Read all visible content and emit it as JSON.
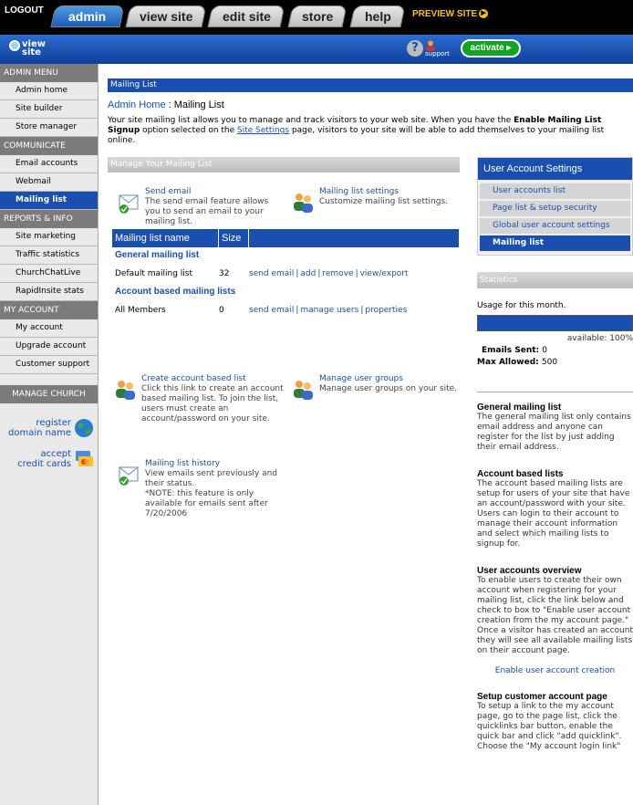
{
  "topbar": {
    "logout": "LOGOUT",
    "tabs": [
      "admin",
      "view site",
      "edit site",
      "store",
      "help"
    ],
    "preview": "PREVIEW SITE",
    "view_site_icon_label": "view site",
    "support_label": "support",
    "activate": "activate"
  },
  "sidebar": {
    "admin_menu": "ADMIN MENU",
    "admin_items": [
      "Admin home",
      "Site builder",
      "Store manager"
    ],
    "communicate": "COMMUNICATE",
    "communicate_items": [
      "Email accounts",
      "Webmail",
      "Mailing list"
    ],
    "reports": "REPORTS & INFO",
    "reports_items": [
      "Site marketing",
      "Traffic statistics",
      "ChurchChatLive",
      "RapidInsite stats"
    ],
    "my_account": "MY ACCOUNT",
    "account_items": [
      "My account",
      "Upgrade account",
      "Customer support"
    ],
    "manage_church": "MANAGE CHURCH",
    "register_domain_1": "register",
    "register_domain_2": "domain name",
    "accept_cards_1": "accept",
    "accept_cards_2": "credit cards"
  },
  "main": {
    "title": "Mailing List",
    "crumb_home": "Admin Home",
    "crumb_sep": " : ",
    "crumb_current": "Mailing List",
    "intro_1": "Your site mailing list allows you to manage and track visitors to your web site. When you have the ",
    "intro_bold": "Enable Mailing List Signup",
    "intro_2": " option selected on the ",
    "intro_link": "Site Settings",
    "intro_3": " page, visitors to your site will be able to add themselves to your mailing list online.",
    "manage_head": "Manage Your Mailing List",
    "send_email_title": "Send email",
    "send_email_desc": "The send email feature allows you to send an email to your mailing list.",
    "settings_title": "Mailing list settings",
    "settings_desc": "Customize mailing list settings.",
    "table_headers": [
      "Mailing list name",
      "Size"
    ],
    "general_section": "General mailing list",
    "general_row": {
      "name": "Default mailing list",
      "size": "32",
      "actions": [
        "send email",
        "add",
        "remove",
        "view/export"
      ]
    },
    "account_section": "Account based mailing lists",
    "account_row": {
      "name": "All Members",
      "size": "0",
      "actions": [
        "send email",
        "manage users",
        "properties"
      ]
    },
    "create_title": "Create account based list",
    "create_desc": "Click this link to create an account based mailing list. To join the list, users must create an account/password on your site.",
    "groups_title": "Manage user groups",
    "groups_desc": "Manage user groups on your site.",
    "history_title": "Mailing list history",
    "history_desc_1": "View emails sent previously and their status.",
    "history_desc_2": "*NOTE: this feature is only available for emails sent after 7/20/2006"
  },
  "right": {
    "uas_head": "User Account Settings",
    "uas_items": [
      "User accounts list",
      "Page list & setup security",
      "Global user account settings",
      "Mailing list"
    ],
    "stats_head": "Statistics",
    "usage": "Usage for this month.",
    "available_label": "available: ",
    "available_value": "100%",
    "emails_sent_label": "Emails Sent: ",
    "emails_sent_value": "0",
    "max_allowed_label": "Max Allowed: ",
    "max_allowed_value": "500",
    "help_general_title": "General mailing list",
    "help_general": "The general mailing list only contains email address and anyone can register for the list by just adding their email address.",
    "help_account_title": "Account based lists",
    "help_account": "The account based mailing lists are setup for users of your site that have an account/password with your site. Users can login to their account to manage their account information and select which mailing lists to signup for.",
    "help_overview_title": "User accounts overview",
    "help_overview": "To enable users to create their own account when registering for your mailing list, click the link below and check to box to \"Enable user account creation from the my account page.\" Once a visitor has created an account they will see all available mailing lists on their account page.",
    "enable_link": "Enable user account creation",
    "help_setup_title": "Setup customer account page",
    "help_setup": "To setup a link to the my account page, go to the page list, click the quicklinks bar button, enable the quick bar and click \"add quicklink\". Choose the \"My account login link\""
  },
  "colors": {
    "accent": "#1a4fb0",
    "topbar": "#000000",
    "activate": "#11a321",
    "preview": "#f5c400"
  }
}
